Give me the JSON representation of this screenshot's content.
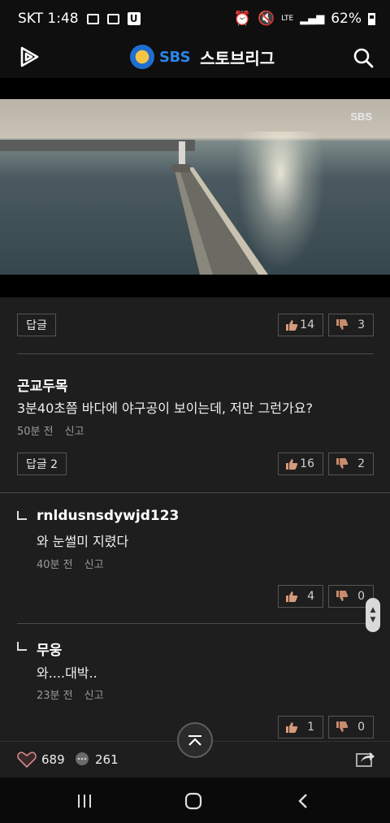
{
  "status": {
    "carrier_time": "SKT 1:48",
    "network": "LTE",
    "battery": "62%"
  },
  "header": {
    "brand_sbs": "SBS",
    "title": "스토브리그"
  },
  "video": {
    "watermark": "SBS"
  },
  "comments": [
    {
      "reply_button": "답글",
      "likes": "14",
      "dislikes": "3"
    },
    {
      "author": "곤교두목",
      "text": "3분40초쯤 바다에 야구공이 보이는데, 저만 그런가요?",
      "time": "50분 전",
      "report": "신고",
      "reply_button": "답글 2",
      "likes": "16",
      "dislikes": "2"
    },
    {
      "author": "rnldusnsdywjd123",
      "text": "와 눈썰미 지렸다",
      "time": "40분 전",
      "report": "신고",
      "likes": "4",
      "dislikes": "0"
    },
    {
      "author": "무웅",
      "text": "와....대박..",
      "time": "23분 전",
      "report": "신고",
      "likes": "1",
      "dislikes": "0"
    }
  ],
  "bottom": {
    "likes": "689",
    "comments": "261"
  }
}
